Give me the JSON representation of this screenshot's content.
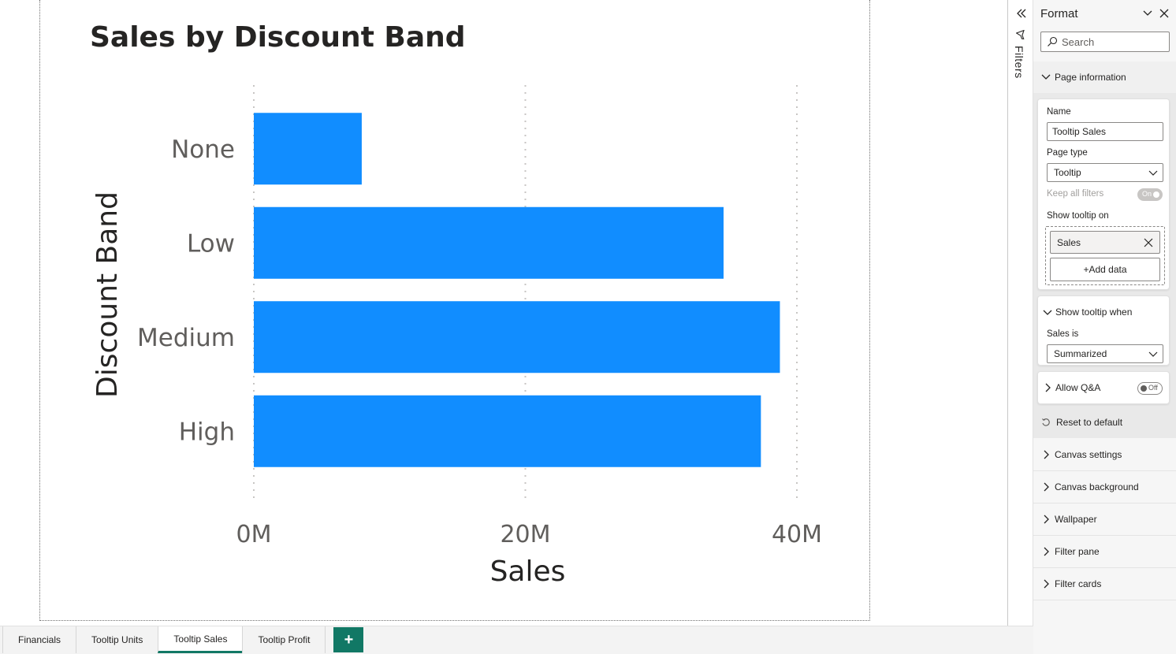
{
  "chart_data": {
    "type": "bar",
    "orientation": "horizontal",
    "title": "Sales by Discount Band",
    "categories": [
      "None",
      "Low",
      "Medium",
      "High"
    ],
    "values": [
      7950000,
      34600000,
      38750000,
      37350000
    ],
    "xlabel": "Sales",
    "ylabel": "Discount Band",
    "xlim": [
      0,
      40000000
    ],
    "x_ticks": [
      0,
      20000000,
      40000000
    ],
    "x_tick_labels": [
      "0M",
      "20M",
      "40M"
    ],
    "grid": "vertical dotted",
    "bar_color": "#118DFF"
  },
  "tabs": [
    {
      "label": "Financials",
      "active": false
    },
    {
      "label": "Tooltip Units",
      "active": false
    },
    {
      "label": "Tooltip Sales",
      "active": true
    },
    {
      "label": "Tooltip Profit",
      "active": false
    }
  ],
  "add_page_label": "+",
  "filters_pane": {
    "label": "Filters"
  },
  "format_pane": {
    "title": "Format",
    "search_placeholder": "Search",
    "page_information": {
      "label": "Page information",
      "name_label": "Name",
      "name_value": "Tooltip Sales",
      "page_type_label": "Page type",
      "page_type_value": "Tooltip",
      "keep_filters_label": "Keep all filters",
      "keep_filters_toggle": "On",
      "show_tooltip_on_label": "Show tooltip on",
      "tooltip_field": "Sales",
      "add_data_label": "+Add data",
      "show_tooltip_when_label": "Show tooltip when",
      "sales_is_label": "Sales is",
      "sales_is_value": "Summarized",
      "allow_qa_label": "Allow Q&A",
      "allow_qa_toggle": "Off",
      "reset_label": "Reset to default"
    },
    "sections": [
      "Canvas settings",
      "Canvas background",
      "Wallpaper",
      "Filter pane",
      "Filter cards"
    ]
  },
  "colors": {
    "accent": "#117865",
    "bar": "#118DFF"
  }
}
